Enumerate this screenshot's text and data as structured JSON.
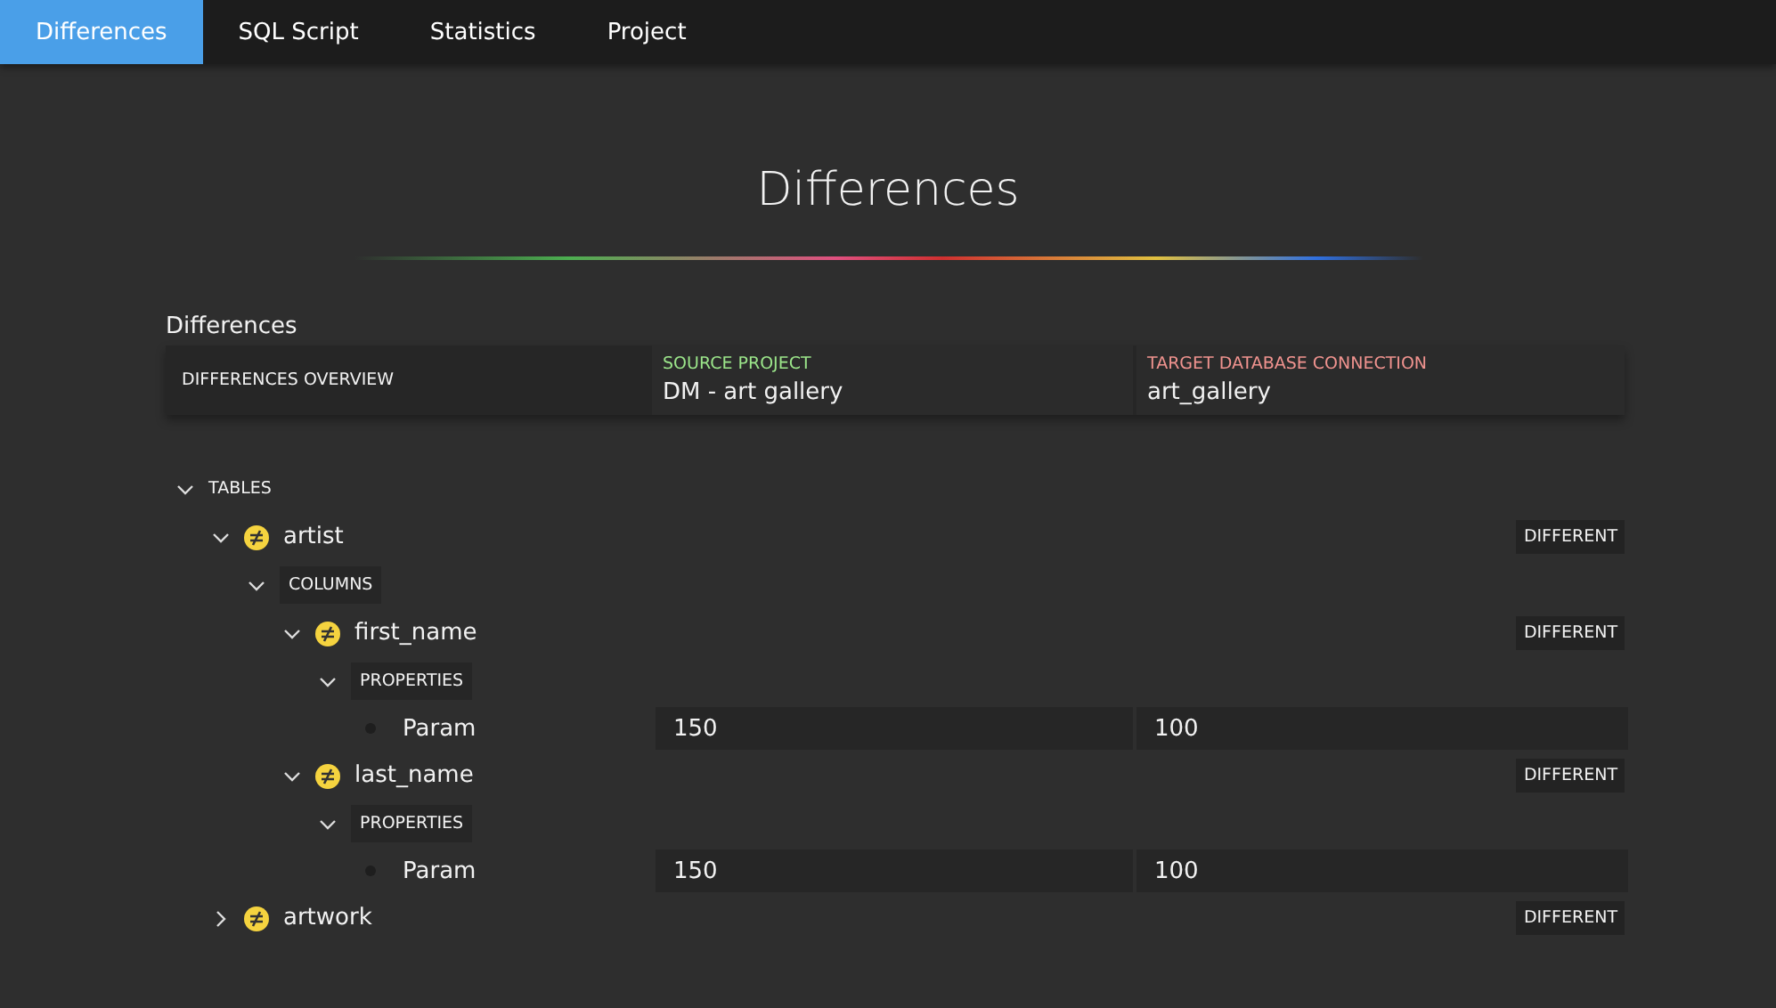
{
  "tabs": [
    {
      "label": "Differences",
      "selected": true
    },
    {
      "label": "SQL Script",
      "selected": false
    },
    {
      "label": "Statistics",
      "selected": false
    },
    {
      "label": "Project",
      "selected": false
    }
  ],
  "page_title": "Differences",
  "section_title": "Differences",
  "overview": {
    "label": "DIFFERENCES OVERVIEW",
    "source": {
      "heading": "SOURCE PROJECT",
      "value": "DM - art gallery"
    },
    "target": {
      "heading": "TARGET DATABASE CONNECTION",
      "value": "art_gallery"
    }
  },
  "tree": [
    {
      "kind": "group",
      "label": "TABLES",
      "expanded": true,
      "children": [
        {
          "kind": "object",
          "name": "artist",
          "status": "DIFFERENT",
          "expanded": true,
          "children": [
            {
              "kind": "group",
              "label": "COLUMNS",
              "expanded": true,
              "children": [
                {
                  "kind": "object",
                  "name": "first_name",
                  "status": "DIFFERENT",
                  "expanded": true,
                  "children": [
                    {
                      "kind": "group",
                      "label": "PROPERTIES",
                      "expanded": true,
                      "children": [
                        {
                          "kind": "property",
                          "name": "Param",
                          "source": "150",
                          "target": "100"
                        }
                      ]
                    }
                  ]
                },
                {
                  "kind": "object",
                  "name": "last_name",
                  "status": "DIFFERENT",
                  "expanded": true,
                  "children": [
                    {
                      "kind": "group",
                      "label": "PROPERTIES",
                      "expanded": true,
                      "children": [
                        {
                          "kind": "property",
                          "name": "Param",
                          "source": "150",
                          "target": "100"
                        }
                      ]
                    }
                  ]
                }
              ]
            }
          ]
        },
        {
          "kind": "object",
          "name": "artwork",
          "status": "DIFFERENT",
          "expanded": false
        }
      ]
    }
  ]
}
